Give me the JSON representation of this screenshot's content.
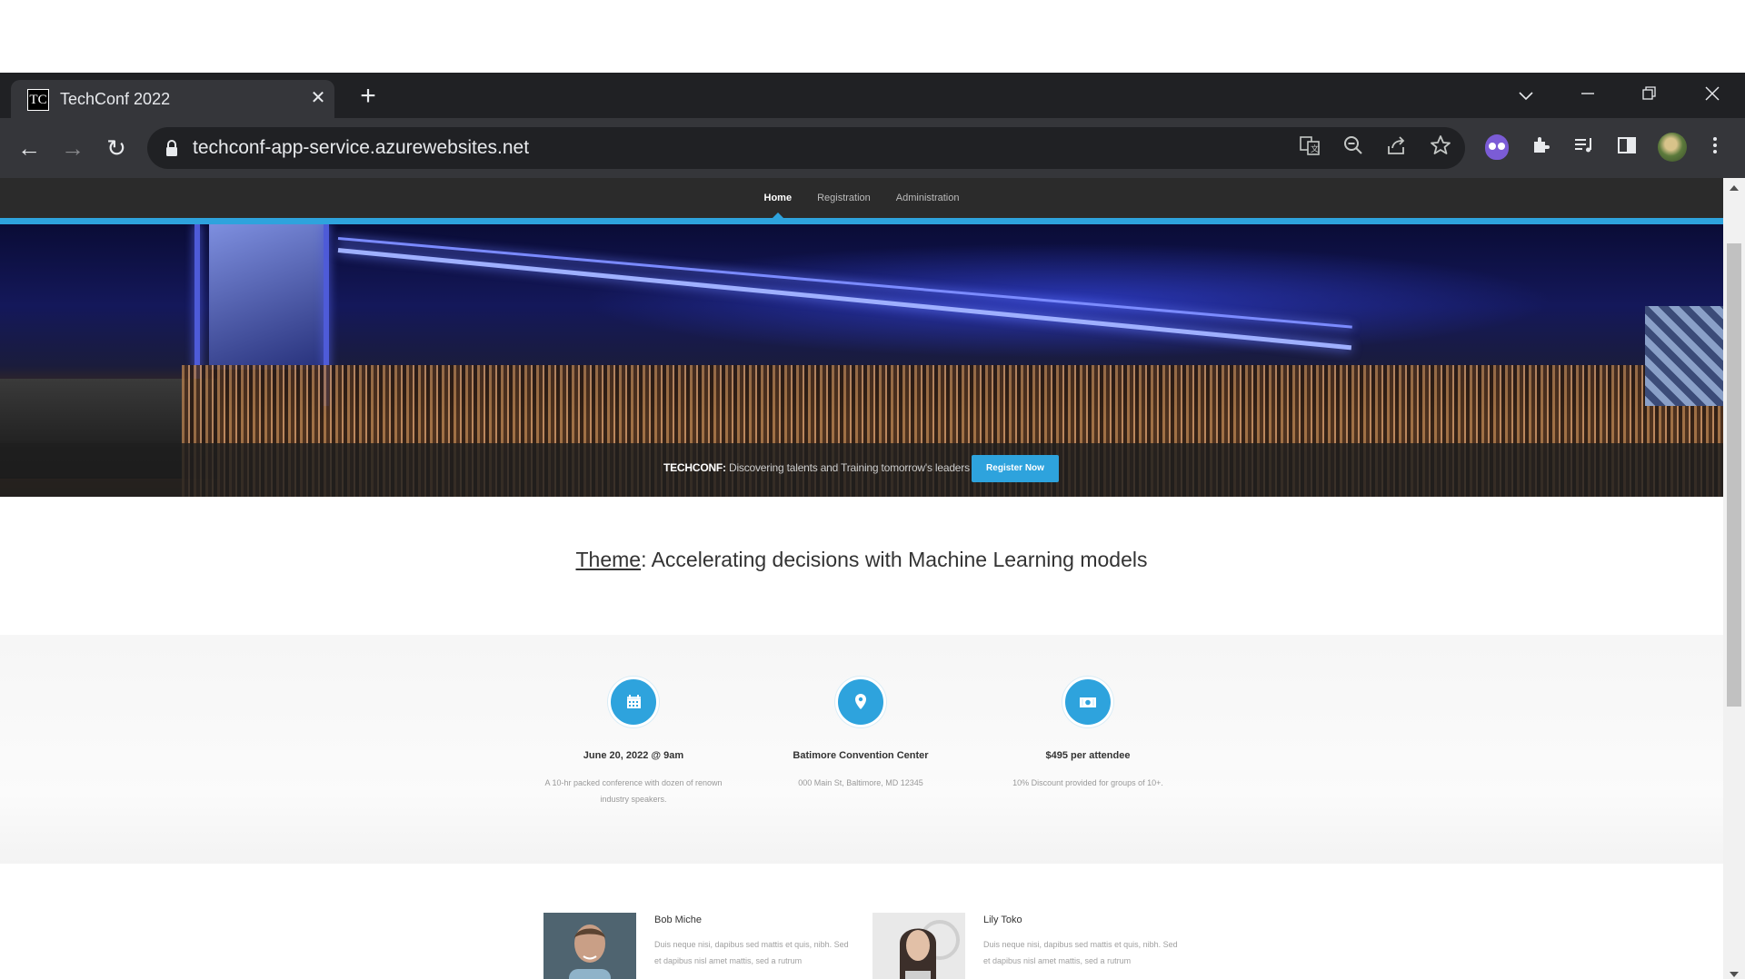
{
  "browser": {
    "tab_title": "TechConf 2022",
    "favicon_text": "TC",
    "url": "techconf-app-service.azurewebsites.net"
  },
  "site": {
    "nav": [
      "Home",
      "Registration",
      "Administration"
    ],
    "active_nav": "Home",
    "accent_color": "#2ea3dd"
  },
  "hero": {
    "brand": "TECHCONF:",
    "tagline": " Discovering talents and Training tomorrow's leaders",
    "register_label": "Register Now"
  },
  "theme": {
    "label": "Theme",
    "text": ": Accelerating decisions with Machine Learning models"
  },
  "info": [
    {
      "icon": "calendar-icon",
      "title": "June 20, 2022 @ 9am",
      "desc": "A 10-hr packed conference with dozen of renown industry speakers."
    },
    {
      "icon": "map-pin-icon",
      "title": "Batimore Convention Center",
      "desc": "000 Main St, Baltimore, MD 12345"
    },
    {
      "icon": "money-icon",
      "title": "$495 per attendee",
      "desc": "10% Discount provided for groups of 10+."
    }
  ],
  "speakers": [
    {
      "name": "Bob Miche",
      "bio": "Duis neque nisi, dapibus sed mattis et quis, nibh. Sed et dapibus nisl amet mattis, sed a rutrum"
    },
    {
      "name": "Lily Toko",
      "bio": "Duis neque nisi, dapibus sed mattis et quis, nibh. Sed et dapibus nisl amet mattis, sed a rutrum"
    }
  ]
}
